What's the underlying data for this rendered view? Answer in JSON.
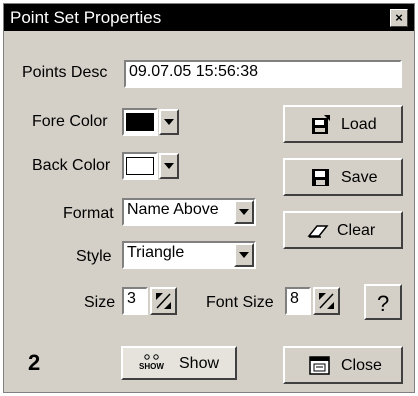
{
  "window": {
    "title": "Point Set Properties",
    "close_glyph": "×"
  },
  "points_desc": {
    "label": "Points Desc",
    "value": "09.07.05 15:56:38"
  },
  "fore_color": {
    "label": "Fore Color",
    "value_hex": "#000000"
  },
  "back_color": {
    "label": "Back Color",
    "value_hex": "#ffffff"
  },
  "format": {
    "label": "Format",
    "value": "Name Above"
  },
  "style": {
    "label": "Style",
    "value": "Triangle"
  },
  "size": {
    "label": "Size",
    "value": "3"
  },
  "font_size": {
    "label": "Font Size",
    "value": "8"
  },
  "buttons": {
    "load": "Load",
    "save": "Save",
    "clear": "Clear",
    "help": "?",
    "show": "Show",
    "show_icon_text": "SHOW",
    "close": "Close"
  },
  "point_count": "2",
  "icons": [
    "load-icon",
    "save-icon",
    "eraser-icon",
    "show-points-icon",
    "close-icon",
    "dropdown-arrow-icon",
    "spin-arrows-icon"
  ],
  "colors": {
    "title_bg": "#000000",
    "dialog_bg": "#d4d0c8"
  }
}
